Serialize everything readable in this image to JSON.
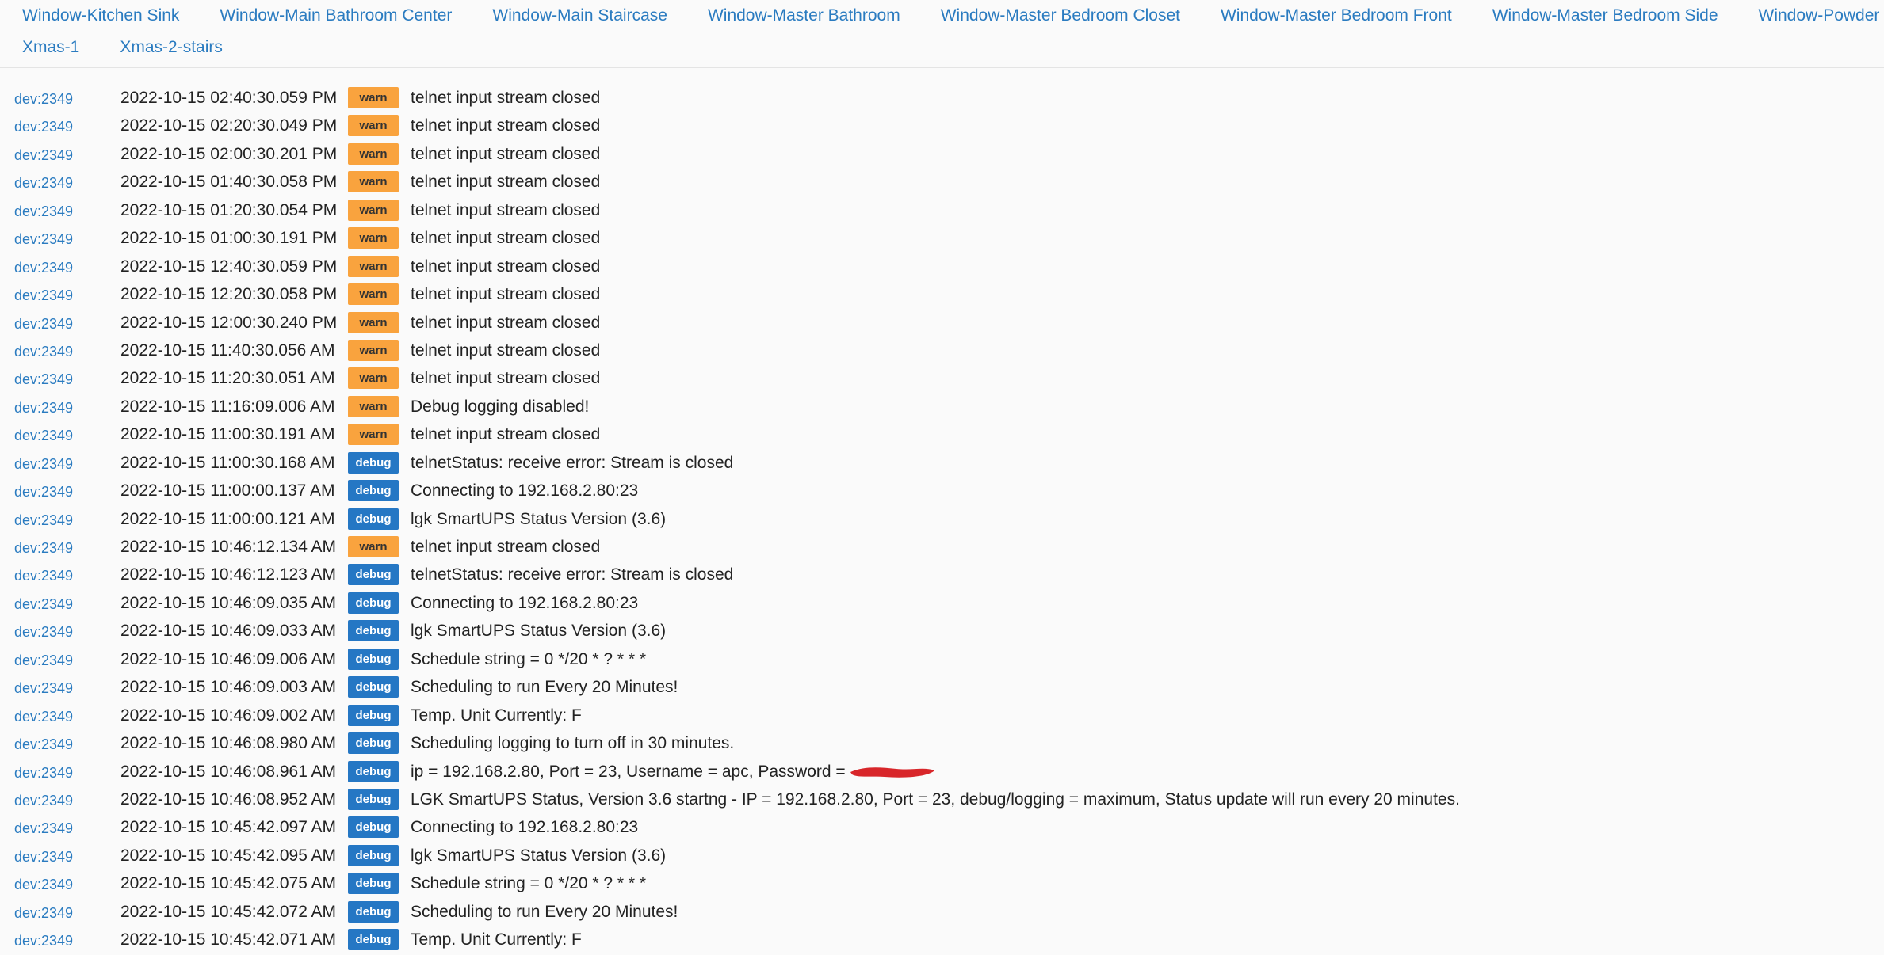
{
  "tabs_row1": [
    "Window-Kitchen Sink",
    "Window-Main Bathroom Center",
    "Window-Main Staircase",
    "Window-Master Bathroom",
    "Window-Master Bedroom Closet",
    "Window-Master Bedroom Front",
    "Window-Master Bedroom Side",
    "Window-Powder"
  ],
  "tabs_row2": [
    "Xmas-1",
    "Xmas-2-stairs"
  ],
  "colors": {
    "warn": "#f9a33e",
    "debug": "#2577c4",
    "link": "#2a7bc0",
    "redaction": "#d8262a"
  },
  "logs": [
    {
      "dev": "dev:2349",
      "time": "2022-10-15 02:40:30.059 PM",
      "level": "warn",
      "msg": "telnet input stream closed"
    },
    {
      "dev": "dev:2349",
      "time": "2022-10-15 02:20:30.049 PM",
      "level": "warn",
      "msg": "telnet input stream closed"
    },
    {
      "dev": "dev:2349",
      "time": "2022-10-15 02:00:30.201 PM",
      "level": "warn",
      "msg": "telnet input stream closed"
    },
    {
      "dev": "dev:2349",
      "time": "2022-10-15 01:40:30.058 PM",
      "level": "warn",
      "msg": "telnet input stream closed"
    },
    {
      "dev": "dev:2349",
      "time": "2022-10-15 01:20:30.054 PM",
      "level": "warn",
      "msg": "telnet input stream closed"
    },
    {
      "dev": "dev:2349",
      "time": "2022-10-15 01:00:30.191 PM",
      "level": "warn",
      "msg": "telnet input stream closed"
    },
    {
      "dev": "dev:2349",
      "time": "2022-10-15 12:40:30.059 PM",
      "level": "warn",
      "msg": "telnet input stream closed"
    },
    {
      "dev": "dev:2349",
      "time": "2022-10-15 12:20:30.058 PM",
      "level": "warn",
      "msg": "telnet input stream closed"
    },
    {
      "dev": "dev:2349",
      "time": "2022-10-15 12:00:30.240 PM",
      "level": "warn",
      "msg": "telnet input stream closed"
    },
    {
      "dev": "dev:2349",
      "time": "2022-10-15 11:40:30.056 AM",
      "level": "warn",
      "msg": "telnet input stream closed"
    },
    {
      "dev": "dev:2349",
      "time": "2022-10-15 11:20:30.051 AM",
      "level": "warn",
      "msg": "telnet input stream closed"
    },
    {
      "dev": "dev:2349",
      "time": "2022-10-15 11:16:09.006 AM",
      "level": "warn",
      "msg": "Debug logging disabled!"
    },
    {
      "dev": "dev:2349",
      "time": "2022-10-15 11:00:30.191 AM",
      "level": "warn",
      "msg": "telnet input stream closed"
    },
    {
      "dev": "dev:2349",
      "time": "2022-10-15 11:00:30.168 AM",
      "level": "debug",
      "msg": "telnetStatus: receive error: Stream is closed"
    },
    {
      "dev": "dev:2349",
      "time": "2022-10-15 11:00:00.137 AM",
      "level": "debug",
      "msg": "Connecting to 192.168.2.80:23"
    },
    {
      "dev": "dev:2349",
      "time": "2022-10-15 11:00:00.121 AM",
      "level": "debug",
      "msg": "lgk SmartUPS Status Version (3.6)"
    },
    {
      "dev": "dev:2349",
      "time": "2022-10-15 10:46:12.134 AM",
      "level": "warn",
      "msg": "telnet input stream closed"
    },
    {
      "dev": "dev:2349",
      "time": "2022-10-15 10:46:12.123 AM",
      "level": "debug",
      "msg": "telnetStatus: receive error: Stream is closed"
    },
    {
      "dev": "dev:2349",
      "time": "2022-10-15 10:46:09.035 AM",
      "level": "debug",
      "msg": "Connecting to 192.168.2.80:23"
    },
    {
      "dev": "dev:2349",
      "time": "2022-10-15 10:46:09.033 AM",
      "level": "debug",
      "msg": "lgk SmartUPS Status Version (3.6)"
    },
    {
      "dev": "dev:2349",
      "time": "2022-10-15 10:46:09.006 AM",
      "level": "debug",
      "msg": "Schedule string = 0 */20 * ? * * *"
    },
    {
      "dev": "dev:2349",
      "time": "2022-10-15 10:46:09.003 AM",
      "level": "debug",
      "msg": "Scheduling to run Every 20 Minutes!"
    },
    {
      "dev": "dev:2349",
      "time": "2022-10-15 10:46:09.002 AM",
      "level": "debug",
      "msg": "Temp. Unit Currently: F"
    },
    {
      "dev": "dev:2349",
      "time": "2022-10-15 10:46:08.980 AM",
      "level": "debug",
      "msg": "Scheduling logging to turn off in 30 minutes."
    },
    {
      "dev": "dev:2349",
      "time": "2022-10-15 10:46:08.961 AM",
      "level": "debug",
      "msg": "ip = 192.168.2.80, Port = 23, Username = apc, Password =",
      "redacted": true
    },
    {
      "dev": "dev:2349",
      "time": "2022-10-15 10:46:08.952 AM",
      "level": "debug",
      "msg": "LGK SmartUPS Status, Version 3.6 startng - IP = 192.168.2.80, Port = 23, debug/logging = maximum, Status update will run every 20 minutes."
    },
    {
      "dev": "dev:2349",
      "time": "2022-10-15 10:45:42.097 AM",
      "level": "debug",
      "msg": "Connecting to 192.168.2.80:23"
    },
    {
      "dev": "dev:2349",
      "time": "2022-10-15 10:45:42.095 AM",
      "level": "debug",
      "msg": "lgk SmartUPS Status Version (3.6)"
    },
    {
      "dev": "dev:2349",
      "time": "2022-10-15 10:45:42.075 AM",
      "level": "debug",
      "msg": "Schedule string = 0 */20 * ? * * *"
    },
    {
      "dev": "dev:2349",
      "time": "2022-10-15 10:45:42.072 AM",
      "level": "debug",
      "msg": "Scheduling to run Every 20 Minutes!"
    },
    {
      "dev": "dev:2349",
      "time": "2022-10-15 10:45:42.071 AM",
      "level": "debug",
      "msg": "Temp. Unit Currently: F"
    }
  ]
}
